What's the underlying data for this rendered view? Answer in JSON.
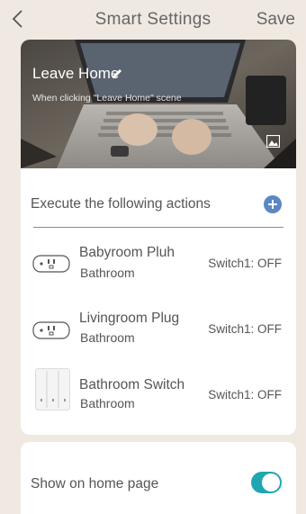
{
  "header": {
    "title": "Smart Settings",
    "save_label": "Save"
  },
  "scene": {
    "title": "Leave Home",
    "subtitle": "When clicking \"Leave Home\" scene"
  },
  "actions": {
    "label": "Execute the following actions",
    "devices": [
      {
        "name": "Babyroom Pluh",
        "room": "Bathroom",
        "state": "Switch1: OFF",
        "icon": "plug-icon"
      },
      {
        "name": "Livingroom Plug",
        "room": "Bathroom",
        "state": "Switch1: OFF",
        "icon": "plug-icon"
      },
      {
        "name": "Bathroom Switch",
        "room": "Bathroom",
        "state": "Switch1: OFF",
        "icon": "wall-switch-icon"
      }
    ]
  },
  "home_page": {
    "label": "Show on home page",
    "enabled": true
  },
  "colors": {
    "background": "#efe9e2",
    "accent_blue": "#5b87c5",
    "toggle_on": "#1fa7b0"
  }
}
